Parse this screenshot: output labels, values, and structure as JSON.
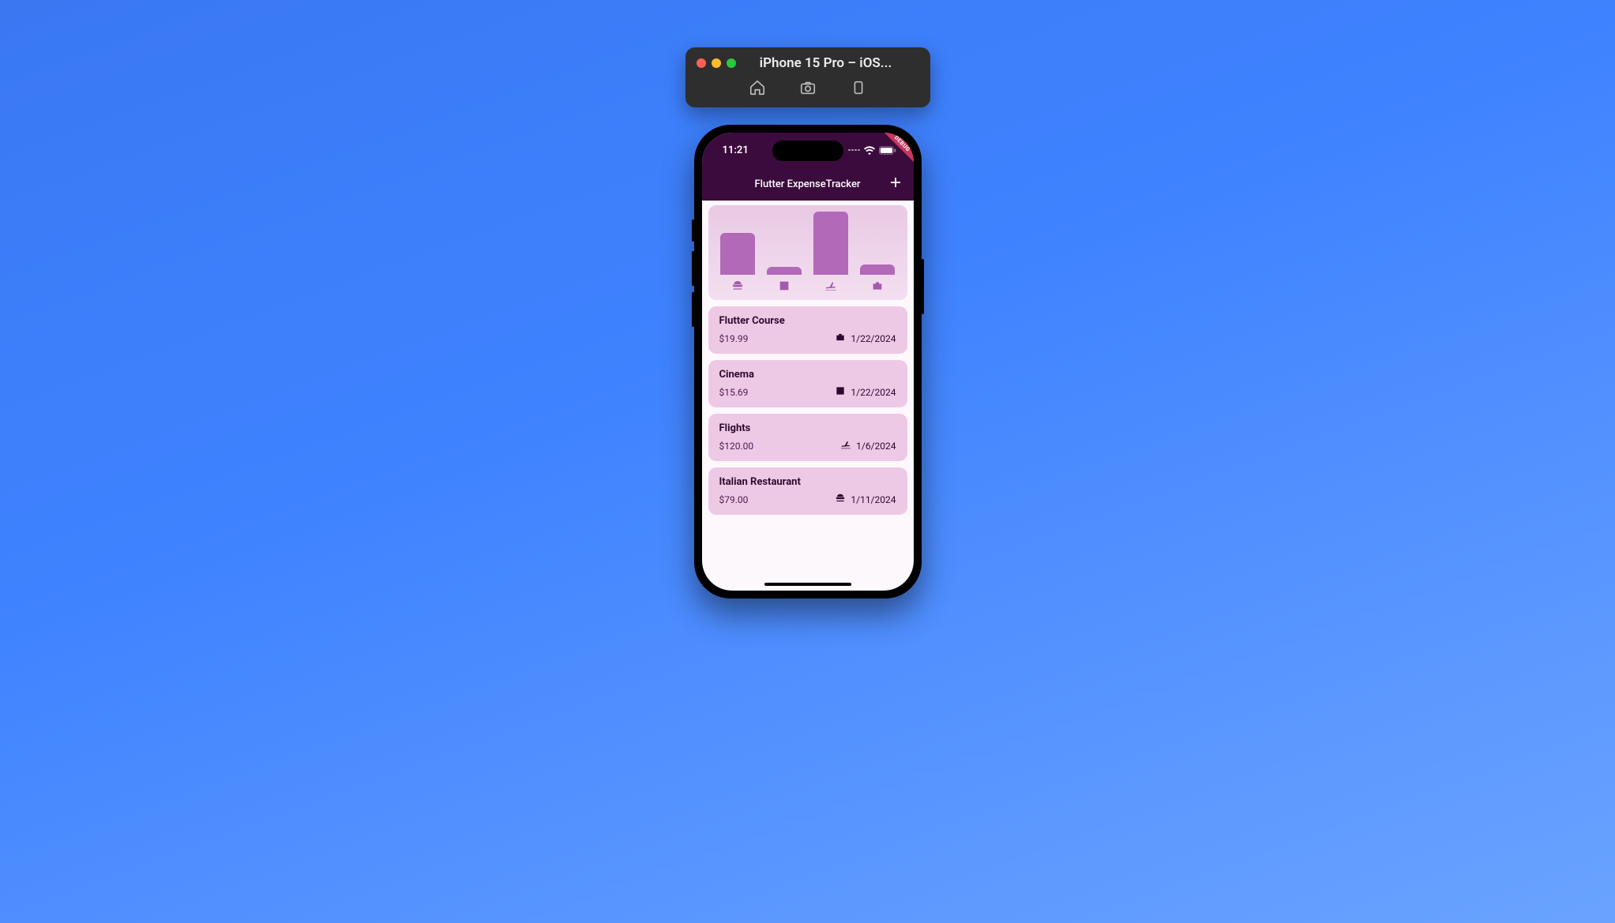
{
  "simulator": {
    "title": "iPhone 15 Pro – iOS..."
  },
  "statusbar": {
    "time": "11:21"
  },
  "debug_label": "DEBUG",
  "appbar": {
    "title": "Flutter ExpenseTracker"
  },
  "chart_data": {
    "type": "bar",
    "categories": [
      "food",
      "leisure",
      "travel",
      "work"
    ],
    "values": [
      79.0,
      15.69,
      120.0,
      19.99
    ],
    "ylim": [
      0,
      120
    ],
    "title": "",
    "xlabel": "",
    "ylabel": ""
  },
  "expenses": [
    {
      "title": "Flutter Course",
      "amount": "$19.99",
      "date": "1/22/2024",
      "icon": "work"
    },
    {
      "title": "Cinema",
      "amount": "$15.69",
      "date": "1/22/2024",
      "icon": "leisure"
    },
    {
      "title": "Flights",
      "amount": "$120.00",
      "date": "1/6/2024",
      "icon": "travel"
    },
    {
      "title": "Italian Restaurant",
      "amount": "$79.00",
      "date": "1/11/2024",
      "icon": "food"
    }
  ]
}
